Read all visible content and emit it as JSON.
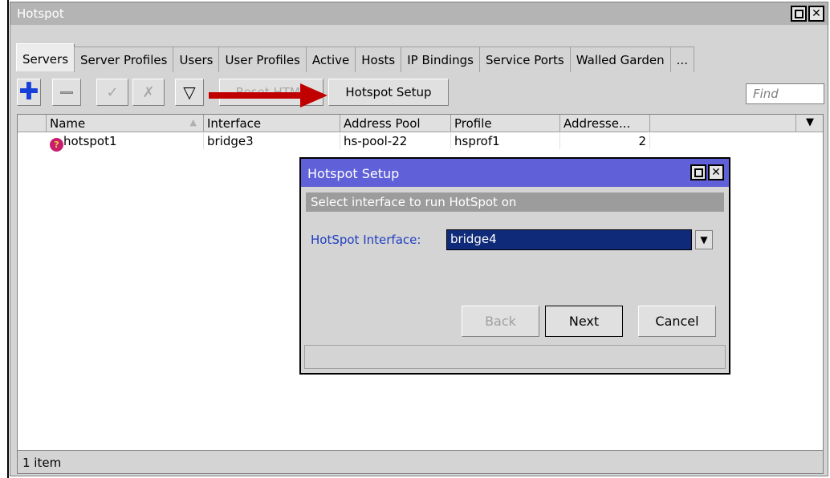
{
  "window": {
    "title": "Hotspot",
    "status": "1 item"
  },
  "tabs": [
    "Servers",
    "Server Profiles",
    "Users",
    "User Profiles",
    "Active",
    "Hosts",
    "IP Bindings",
    "Service Ports",
    "Walled Garden",
    "..."
  ],
  "toolbar": {
    "reset_html_label": "Reset HTML",
    "hotspot_setup_label": "Hotspot Setup",
    "find_placeholder": "Find"
  },
  "table": {
    "columns": [
      "Name",
      "Interface",
      "Address Pool",
      "Profile",
      "Addresse..."
    ],
    "rows": [
      {
        "name": "hotspot1",
        "interface": "bridge3",
        "address_pool": "hs-pool-22",
        "profile": "hsprof1",
        "addresses": "2"
      }
    ]
  },
  "dialog": {
    "title": "Hotspot Setup",
    "subtitle": "Select interface to run HotSpot on",
    "interface_label": "HotSpot Interface:",
    "interface_value": "bridge4",
    "back_label": "Back",
    "next_label": "Next",
    "cancel_label": "Cancel"
  },
  "colors": {
    "dialog_title": "#6060d8",
    "arrow": "#c00000",
    "selection": "#0e2a78"
  }
}
